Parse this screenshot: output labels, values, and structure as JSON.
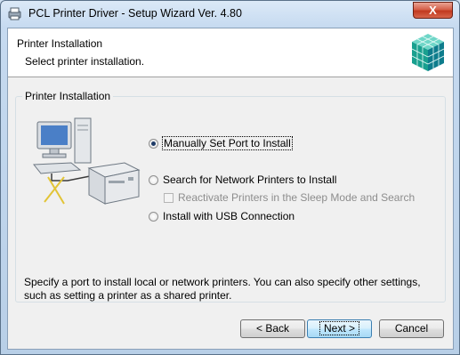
{
  "window": {
    "title": "PCL Printer Driver - Setup Wizard Ver. 4.80",
    "close_label": "X"
  },
  "header": {
    "title": "Printer Installation",
    "subtitle": "Select printer installation."
  },
  "group": {
    "legend": "Printer Installation",
    "options": [
      {
        "label": "Manually Set Port to Install",
        "selected": true
      },
      {
        "label": "Search for Network Printers to Install",
        "selected": false
      },
      {
        "label": "Reactivate Printers in the Sleep Mode and Search",
        "checked": false,
        "enabled": false
      },
      {
        "label": "Install with USB Connection",
        "selected": false
      }
    ],
    "description": "Specify a port to install local or network printers. You can also specify other settings, such as setting a printer as a shared printer."
  },
  "buttons": {
    "back": "< Back",
    "next": "Next >",
    "cancel": "Cancel"
  },
  "colors": {
    "client_bg": "#f0f0f0",
    "close_red": "#c13a1f",
    "default_button_border": "#3c7fb1"
  }
}
